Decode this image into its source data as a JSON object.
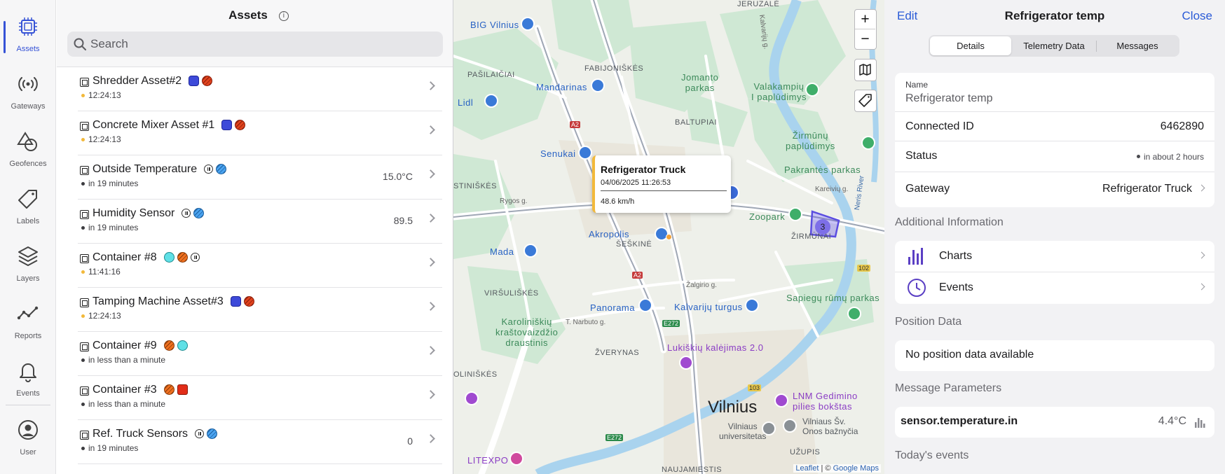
{
  "nav": {
    "items": [
      {
        "label": "Assets",
        "icon": "chip-icon"
      },
      {
        "label": "Gateways",
        "icon": "broadcast-icon"
      },
      {
        "label": "Geofences",
        "icon": "shapes-icon"
      },
      {
        "label": "Labels",
        "icon": "tag-icon"
      },
      {
        "label": "Layers",
        "icon": "layers-icon"
      },
      {
        "label": "Reports",
        "icon": "trend-line-icon"
      },
      {
        "label": "Events",
        "icon": "bell-icon"
      },
      {
        "label": "User",
        "icon": "user-circle-icon"
      }
    ],
    "accent": "#3552d6"
  },
  "assets": {
    "title": "Assets",
    "search_placeholder": "Search",
    "rows": [
      {
        "name": "Shredder Asset#2",
        "status": "12:24:13",
        "value": "",
        "dot": "#f2b93b",
        "badges": [
          "blue",
          "red"
        ]
      },
      {
        "name": "Concrete Mixer Asset #1",
        "status": "12:24:13",
        "value": "",
        "dot": "#f2b93b",
        "badges": [
          "blue",
          "red"
        ]
      },
      {
        "name": "Outside Temperature",
        "status": "in 19 minutes",
        "value": "15.0°C",
        "dot": "#3c3c40",
        "badges": [
          "pause",
          "sky"
        ]
      },
      {
        "name": "Humidity Sensor",
        "status": "in 19 minutes",
        "value": "89.5",
        "dot": "#3c3c40",
        "badges": [
          "pause",
          "sky"
        ]
      },
      {
        "name": "Container #8",
        "status": "11:41:16",
        "value": "",
        "dot": "#f2b93b",
        "badges": [
          "cyan",
          "orange",
          "pause"
        ]
      },
      {
        "name": "Tamping Machine Asset#3",
        "status": "12:24:13",
        "value": "",
        "dot": "#f2b93b",
        "badges": [
          "blue",
          "red"
        ]
      },
      {
        "name": "Container #9",
        "status": "in less than a minute",
        "value": "",
        "dot": "#3c3c40",
        "badges": [
          "orange",
          "cyan"
        ]
      },
      {
        "name": "Container #3",
        "status": "in less than a minute",
        "value": "",
        "dot": "#3c3c40",
        "badges": [
          "orange",
          "redsq"
        ]
      },
      {
        "name": "Ref. Truck Sensors",
        "status": "in 19 minutes",
        "value": "0",
        "dot": "#3c3c40",
        "badges": [
          "pause",
          "sky"
        ]
      }
    ]
  },
  "map": {
    "zoom_in": "+",
    "zoom_out": "−",
    "popup": {
      "title": "Refrigerator Truck",
      "date": "04/06/2025 11:26:53",
      "speed": "48.6 km/h"
    },
    "cluster_count": "3",
    "attribution": {
      "leaflet": "Leaflet",
      "sep": "| ©",
      "maps": "Google Maps"
    },
    "labels": {
      "jeruzale": "JERUZALĖ",
      "big_vilnius": "BIG Vilnius",
      "fabijoniskes": "FABIJONIŠKĖS",
      "pasilaiciai": "PAŠILAIČIAI",
      "mandarinas": "Mandarinas",
      "jomanto": "Jomanto\nparkas",
      "valakampiu": "Valakampių\nI paplūdimys",
      "lidl": "Lidl",
      "baltupiai": "BALTUPIAI",
      "zirmunu_pap": "Žirmūnų\npaplūdimys",
      "senukai": "Senukai",
      "pakrantes": "Pakrantės parkas",
      "justiniskes": "STINIŠKĖS",
      "rygos": "Rygos g.",
      "zoopark": "Zoopark",
      "zirmunai": "ŽIRMŪNAI",
      "akropolis": "Akropolis",
      "mada": "Mada",
      "seskine": "ŠEŠKINĖ",
      "a2": "A2",
      "a2b": "A2",
      "r102": "102",
      "virsuliskes": "VIRŠULIŠKĖS",
      "panorama": "Panorama",
      "kalvariju_turgus": "Kalvarijų turgus",
      "sapiegu": "Sapiegų rūmų parkas",
      "e272": "E272",
      "e272b": "E272",
      "karoliniskiu": "Karoliniškių\nkraštovaizdžio\ndraustinis",
      "lukiskiu": "Lukiškių kalėjimas 2.0",
      "zverynas": "ŽVERYNAS",
      "oliniskes": "OLINIŠKĖS",
      "r103": "103",
      "lnm": "LNM Gedimino\npilies bokštas",
      "vilnius": "Vilnius",
      "vu": "Vilniaus\nuniversitetas",
      "onos": "Vilniaus Šv.\nOnos bažnyčia",
      "litexpo": "LITEXPO",
      "uzupis": "UŽUPIS",
      "naujamiestis": "NAUJAMIESTIS",
      "kalvariju_g": "Kalvarijų g.",
      "zalgirio": "Žalgirio g.",
      "narbuto": "T. Narbuto g.",
      "kareiviu": "Kareivių g.",
      "neris_river": "Neris River"
    }
  },
  "detail": {
    "edit": "Edit",
    "title": "Refrigerator temp",
    "close": "Close",
    "tabs": [
      "Details",
      "Telemetry Data",
      "Messages"
    ],
    "name_label": "Name",
    "name_value": "Refrigerator temp",
    "connected_id_label": "Connected ID",
    "connected_id_value": "6462890",
    "status_label": "Status",
    "status_value": "in about 2 hours",
    "gateway_label": "Gateway",
    "gateway_value": "Refrigerator Truck",
    "additional_header": "Additional Information",
    "charts_label": "Charts",
    "events_label": "Events",
    "position_header": "Position Data",
    "position_empty": "No position data available",
    "message_header": "Message Parameters",
    "param_name": "sensor.temperature.in",
    "param_value": "4.4°C",
    "todays_header": "Today's events",
    "accent": "#2a5bd7",
    "icon_color": "#5a3fc4"
  }
}
